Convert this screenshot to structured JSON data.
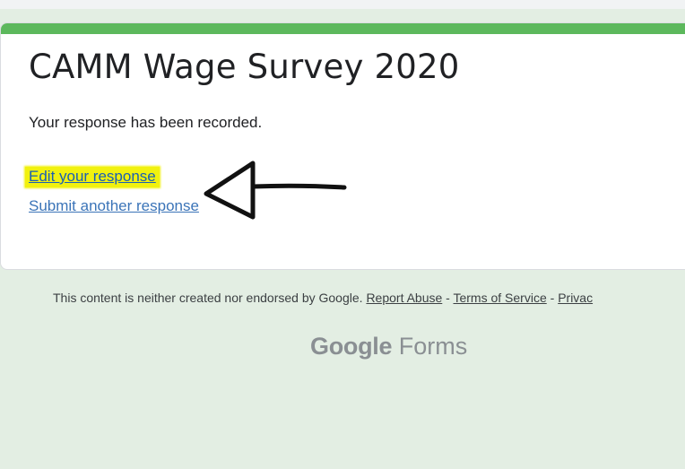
{
  "card": {
    "title": "CAMM Wage Survey 2020",
    "confirmation": "Your response has been recorded.",
    "edit_link": "Edit your response",
    "submit_another_link": "Submit another response"
  },
  "footer": {
    "disclaimer": "This content is neither created nor endorsed by Google.",
    "report_abuse": "Report Abuse",
    "separator": "-",
    "terms": "Terms of Service",
    "privacy": "Privac"
  },
  "brand": {
    "google": "Google",
    "forms": "Forms"
  },
  "colors": {
    "accent": "#5cb85c",
    "background": "#e3eee3",
    "highlight": "#f1f10f",
    "link": "#1a5fb4"
  }
}
